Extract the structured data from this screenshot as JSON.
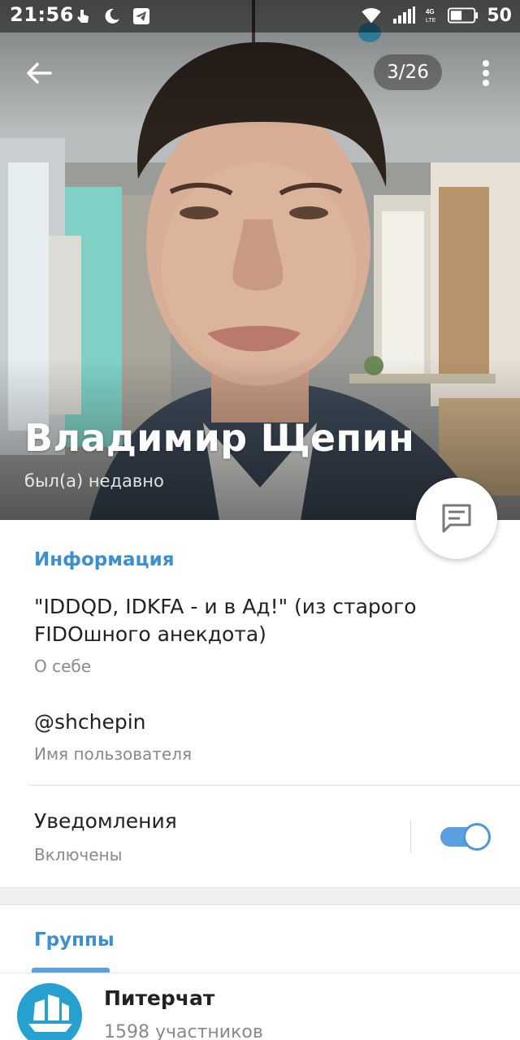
{
  "status_bar": {
    "time": "21:56",
    "battery_level": "50",
    "network": "4G LTE"
  },
  "toolbar": {
    "photo_counter": "3/26"
  },
  "profile": {
    "name": "Владимир Щепин",
    "last_seen": "был(а) недавно"
  },
  "info": {
    "section_title": "Информация",
    "bio": "\"IDDQD, IDKFA - и в Ад!\" (из старого FIDOшного анекдота)",
    "bio_label": "О себе",
    "username": "@shchepin",
    "username_label": "Имя пользователя",
    "notifications_title": "Уведомления",
    "notifications_status": "Включены",
    "notifications_enabled": true
  },
  "groups": {
    "section_title": "Группы",
    "items": [
      {
        "name": "Питерчат",
        "members": "1598 участников"
      }
    ]
  },
  "colors": {
    "accent": "#3d8fd0",
    "toggle": "#5aa0e0",
    "group_avatar": "#25a0cf"
  }
}
